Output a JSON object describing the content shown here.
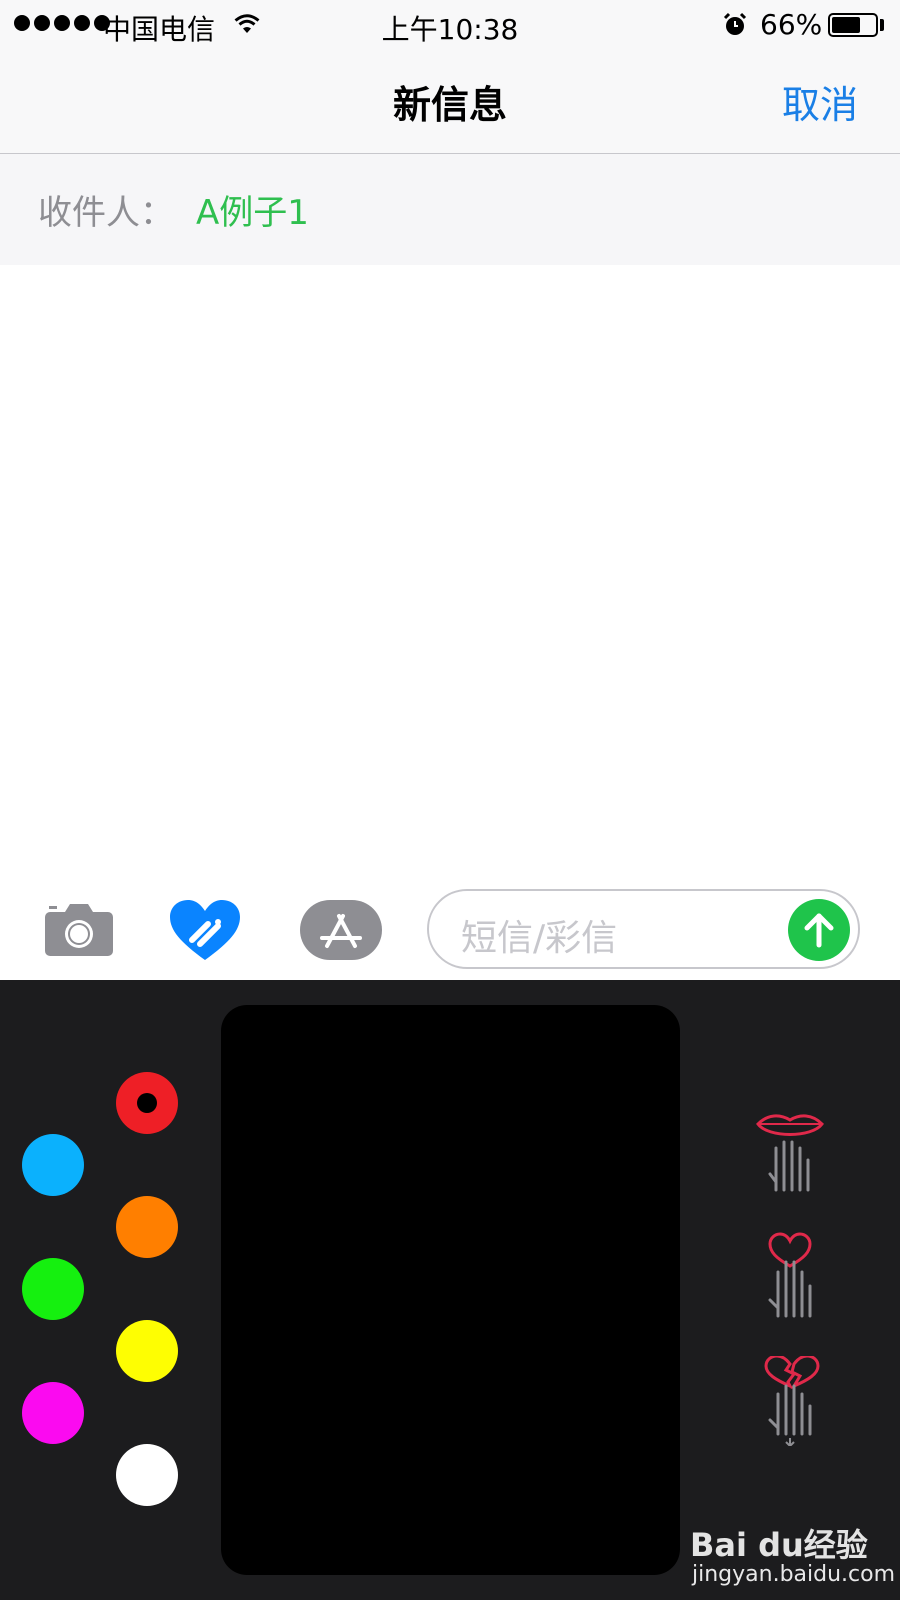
{
  "status_bar": {
    "carrier": "中国电信",
    "time": "上午10:38",
    "battery_percent": "66%",
    "battery_level": 0.66,
    "signal_dots": 5,
    "icons": [
      "wifi-icon",
      "alarm-icon",
      "battery-icon"
    ]
  },
  "nav": {
    "title": "新信息",
    "cancel_label": "取消"
  },
  "recipient": {
    "label": "收件人：",
    "value": "A例子1",
    "value_color": "#2fbf4f"
  },
  "compose": {
    "tools": [
      "camera-icon",
      "digital-touch-heart-icon",
      "app-store-icon"
    ],
    "input_placeholder": "短信/彩信",
    "send_button_color": "#1fc44b"
  },
  "digital_touch": {
    "colors": [
      {
        "name": "red",
        "hex": "#ee1f26",
        "selected": true
      },
      {
        "name": "blue",
        "hex": "#0bb1fd",
        "selected": false
      },
      {
        "name": "orange",
        "hex": "#ff7f00",
        "selected": false
      },
      {
        "name": "green",
        "hex": "#15f00f",
        "selected": false
      },
      {
        "name": "yellow",
        "hex": "#fefe02",
        "selected": false
      },
      {
        "name": "magenta",
        "hex": "#fb0af0",
        "selected": false
      },
      {
        "name": "white",
        "hex": "#ffffff",
        "selected": false
      }
    ],
    "gestures": [
      "kiss-gesture-icon",
      "heartbeat-gesture-icon",
      "heartbreak-gesture-icon"
    ]
  },
  "watermark": {
    "brand": "Bai du经验",
    "url": "jingyan.baidu.com"
  }
}
